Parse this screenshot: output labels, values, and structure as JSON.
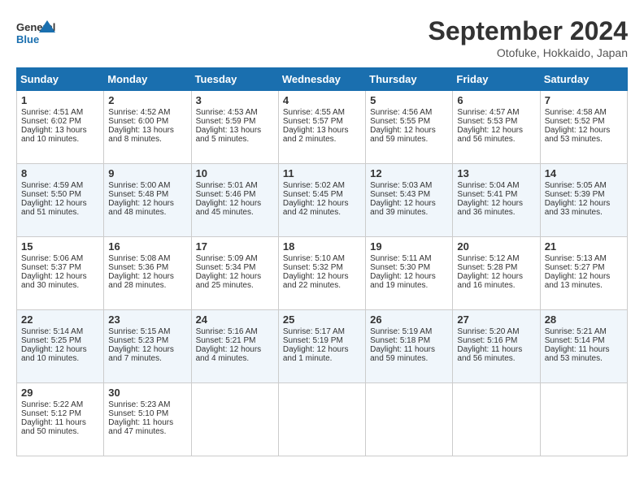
{
  "header": {
    "logo_line1": "General",
    "logo_line2": "Blue",
    "month": "September 2024",
    "location": "Otofuke, Hokkaido, Japan"
  },
  "weekdays": [
    "Sunday",
    "Monday",
    "Tuesday",
    "Wednesday",
    "Thursday",
    "Friday",
    "Saturday"
  ],
  "weeks": [
    [
      {
        "day": "1",
        "lines": [
          "Sunrise: 4:51 AM",
          "Sunset: 6:02 PM",
          "Daylight: 13 hours",
          "and 10 minutes."
        ]
      },
      {
        "day": "2",
        "lines": [
          "Sunrise: 4:52 AM",
          "Sunset: 6:00 PM",
          "Daylight: 13 hours",
          "and 8 minutes."
        ]
      },
      {
        "day": "3",
        "lines": [
          "Sunrise: 4:53 AM",
          "Sunset: 5:59 PM",
          "Daylight: 13 hours",
          "and 5 minutes."
        ]
      },
      {
        "day": "4",
        "lines": [
          "Sunrise: 4:55 AM",
          "Sunset: 5:57 PM",
          "Daylight: 13 hours",
          "and 2 minutes."
        ]
      },
      {
        "day": "5",
        "lines": [
          "Sunrise: 4:56 AM",
          "Sunset: 5:55 PM",
          "Daylight: 12 hours",
          "and 59 minutes."
        ]
      },
      {
        "day": "6",
        "lines": [
          "Sunrise: 4:57 AM",
          "Sunset: 5:53 PM",
          "Daylight: 12 hours",
          "and 56 minutes."
        ]
      },
      {
        "day": "7",
        "lines": [
          "Sunrise: 4:58 AM",
          "Sunset: 5:52 PM",
          "Daylight: 12 hours",
          "and 53 minutes."
        ]
      }
    ],
    [
      {
        "day": "8",
        "lines": [
          "Sunrise: 4:59 AM",
          "Sunset: 5:50 PM",
          "Daylight: 12 hours",
          "and 51 minutes."
        ]
      },
      {
        "day": "9",
        "lines": [
          "Sunrise: 5:00 AM",
          "Sunset: 5:48 PM",
          "Daylight: 12 hours",
          "and 48 minutes."
        ]
      },
      {
        "day": "10",
        "lines": [
          "Sunrise: 5:01 AM",
          "Sunset: 5:46 PM",
          "Daylight: 12 hours",
          "and 45 minutes."
        ]
      },
      {
        "day": "11",
        "lines": [
          "Sunrise: 5:02 AM",
          "Sunset: 5:45 PM",
          "Daylight: 12 hours",
          "and 42 minutes."
        ]
      },
      {
        "day": "12",
        "lines": [
          "Sunrise: 5:03 AM",
          "Sunset: 5:43 PM",
          "Daylight: 12 hours",
          "and 39 minutes."
        ]
      },
      {
        "day": "13",
        "lines": [
          "Sunrise: 5:04 AM",
          "Sunset: 5:41 PM",
          "Daylight: 12 hours",
          "and 36 minutes."
        ]
      },
      {
        "day": "14",
        "lines": [
          "Sunrise: 5:05 AM",
          "Sunset: 5:39 PM",
          "Daylight: 12 hours",
          "and 33 minutes."
        ]
      }
    ],
    [
      {
        "day": "15",
        "lines": [
          "Sunrise: 5:06 AM",
          "Sunset: 5:37 PM",
          "Daylight: 12 hours",
          "and 30 minutes."
        ]
      },
      {
        "day": "16",
        "lines": [
          "Sunrise: 5:08 AM",
          "Sunset: 5:36 PM",
          "Daylight: 12 hours",
          "and 28 minutes."
        ]
      },
      {
        "day": "17",
        "lines": [
          "Sunrise: 5:09 AM",
          "Sunset: 5:34 PM",
          "Daylight: 12 hours",
          "and 25 minutes."
        ]
      },
      {
        "day": "18",
        "lines": [
          "Sunrise: 5:10 AM",
          "Sunset: 5:32 PM",
          "Daylight: 12 hours",
          "and 22 minutes."
        ]
      },
      {
        "day": "19",
        "lines": [
          "Sunrise: 5:11 AM",
          "Sunset: 5:30 PM",
          "Daylight: 12 hours",
          "and 19 minutes."
        ]
      },
      {
        "day": "20",
        "lines": [
          "Sunrise: 5:12 AM",
          "Sunset: 5:28 PM",
          "Daylight: 12 hours",
          "and 16 minutes."
        ]
      },
      {
        "day": "21",
        "lines": [
          "Sunrise: 5:13 AM",
          "Sunset: 5:27 PM",
          "Daylight: 12 hours",
          "and 13 minutes."
        ]
      }
    ],
    [
      {
        "day": "22",
        "lines": [
          "Sunrise: 5:14 AM",
          "Sunset: 5:25 PM",
          "Daylight: 12 hours",
          "and 10 minutes."
        ]
      },
      {
        "day": "23",
        "lines": [
          "Sunrise: 5:15 AM",
          "Sunset: 5:23 PM",
          "Daylight: 12 hours",
          "and 7 minutes."
        ]
      },
      {
        "day": "24",
        "lines": [
          "Sunrise: 5:16 AM",
          "Sunset: 5:21 PM",
          "Daylight: 12 hours",
          "and 4 minutes."
        ]
      },
      {
        "day": "25",
        "lines": [
          "Sunrise: 5:17 AM",
          "Sunset: 5:19 PM",
          "Daylight: 12 hours",
          "and 1 minute."
        ]
      },
      {
        "day": "26",
        "lines": [
          "Sunrise: 5:19 AM",
          "Sunset: 5:18 PM",
          "Daylight: 11 hours",
          "and 59 minutes."
        ]
      },
      {
        "day": "27",
        "lines": [
          "Sunrise: 5:20 AM",
          "Sunset: 5:16 PM",
          "Daylight: 11 hours",
          "and 56 minutes."
        ]
      },
      {
        "day": "28",
        "lines": [
          "Sunrise: 5:21 AM",
          "Sunset: 5:14 PM",
          "Daylight: 11 hours",
          "and 53 minutes."
        ]
      }
    ],
    [
      {
        "day": "29",
        "lines": [
          "Sunrise: 5:22 AM",
          "Sunset: 5:12 PM",
          "Daylight: 11 hours",
          "and 50 minutes."
        ]
      },
      {
        "day": "30",
        "lines": [
          "Sunrise: 5:23 AM",
          "Sunset: 5:10 PM",
          "Daylight: 11 hours",
          "and 47 minutes."
        ]
      },
      {
        "day": "",
        "lines": []
      },
      {
        "day": "",
        "lines": []
      },
      {
        "day": "",
        "lines": []
      },
      {
        "day": "",
        "lines": []
      },
      {
        "day": "",
        "lines": []
      }
    ]
  ]
}
